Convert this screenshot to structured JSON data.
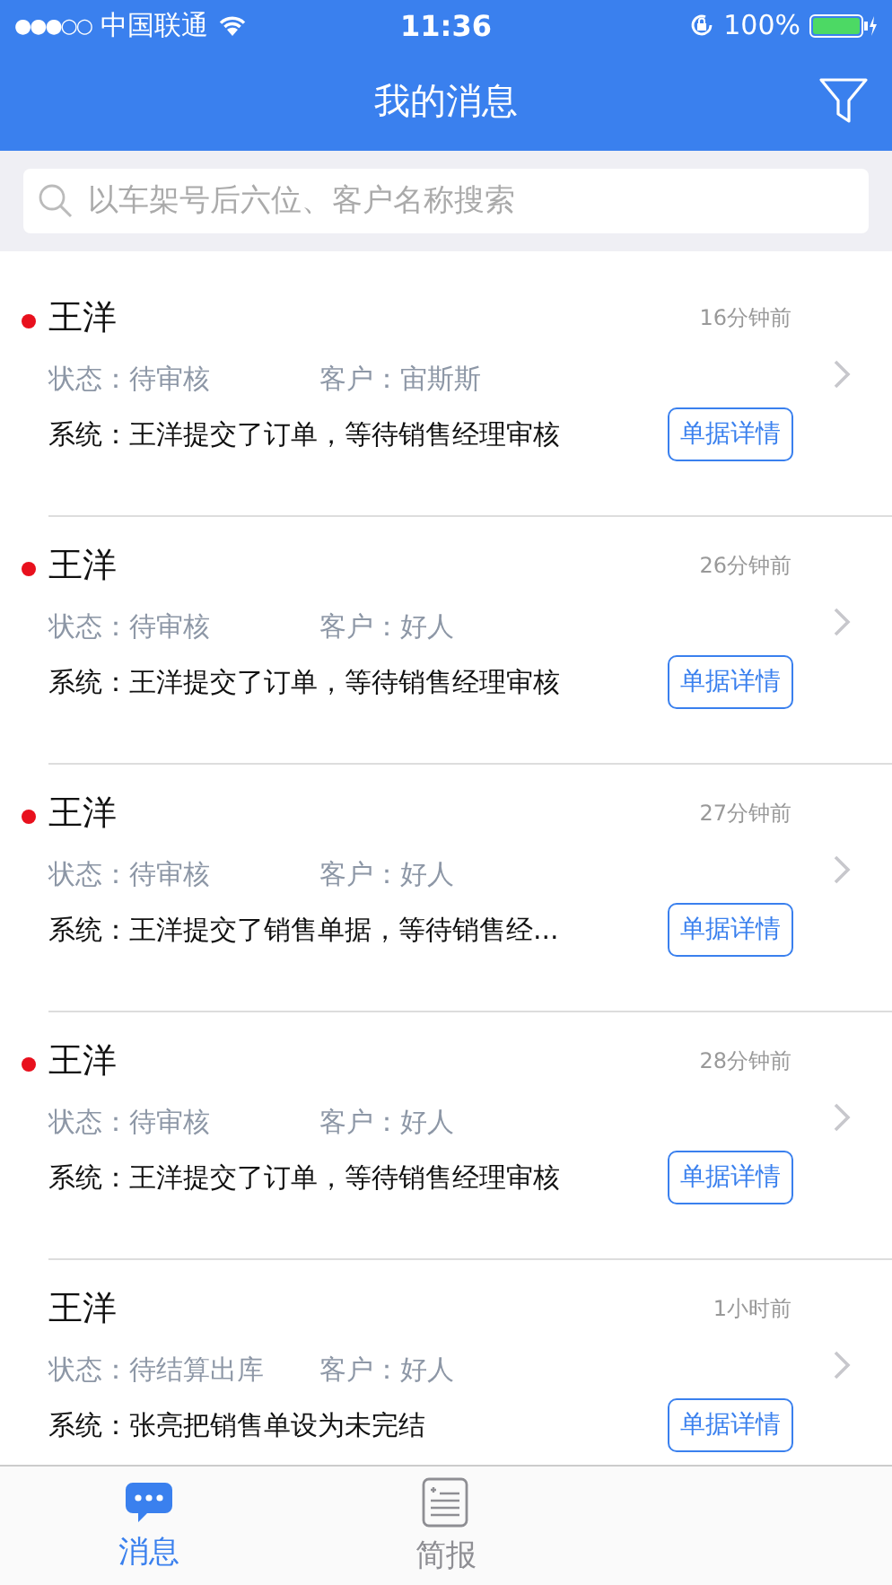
{
  "status_bar": {
    "signal": "●●●○○",
    "carrier": "中国联通",
    "time": "11:36",
    "battery": "100%"
  },
  "nav_bar": {
    "title": "我的消息"
  },
  "search": {
    "placeholder": "以车架号后六位、客户名称搜索"
  },
  "messages": [
    {
      "sender": "王洋",
      "unread": true,
      "time": "16分钟前",
      "status_label": "状态：",
      "status": "待审核",
      "customer_label": "客户：",
      "customer": "宙斯斯",
      "system": "系统：王洋提交了订单，等待销售经理审核",
      "button": "单据详情"
    },
    {
      "sender": "王洋",
      "unread": true,
      "time": "26分钟前",
      "status_label": "状态：",
      "status": "待审核",
      "customer_label": "客户：",
      "customer": "好人",
      "system": "系统：王洋提交了订单，等待销售经理审核",
      "button": "单据详情"
    },
    {
      "sender": "王洋",
      "unread": true,
      "time": "27分钟前",
      "status_label": "状态：",
      "status": "待审核",
      "customer_label": "客户：",
      "customer": "好人",
      "system": "系统：王洋提交了销售单据，等待销售经...",
      "button": "单据详情"
    },
    {
      "sender": "王洋",
      "unread": true,
      "time": "28分钟前",
      "status_label": "状态：",
      "status": "待审核",
      "customer_label": "客户：",
      "customer": "好人",
      "system": "系统：王洋提交了订单，等待销售经理审核",
      "button": "单据详情"
    },
    {
      "sender": "王洋",
      "unread": false,
      "time": "1小时前",
      "status_label": "状态：",
      "status": "待结算出库",
      "customer_label": "客户：",
      "customer": "好人",
      "system": "系统：张亮把销售单设为未完结",
      "button": "单据详情"
    }
  ],
  "tab_bar": [
    {
      "label": "消息",
      "kind": "chat",
      "selected": true
    },
    {
      "label": "简报",
      "kind": "report",
      "selected": false
    }
  ]
}
